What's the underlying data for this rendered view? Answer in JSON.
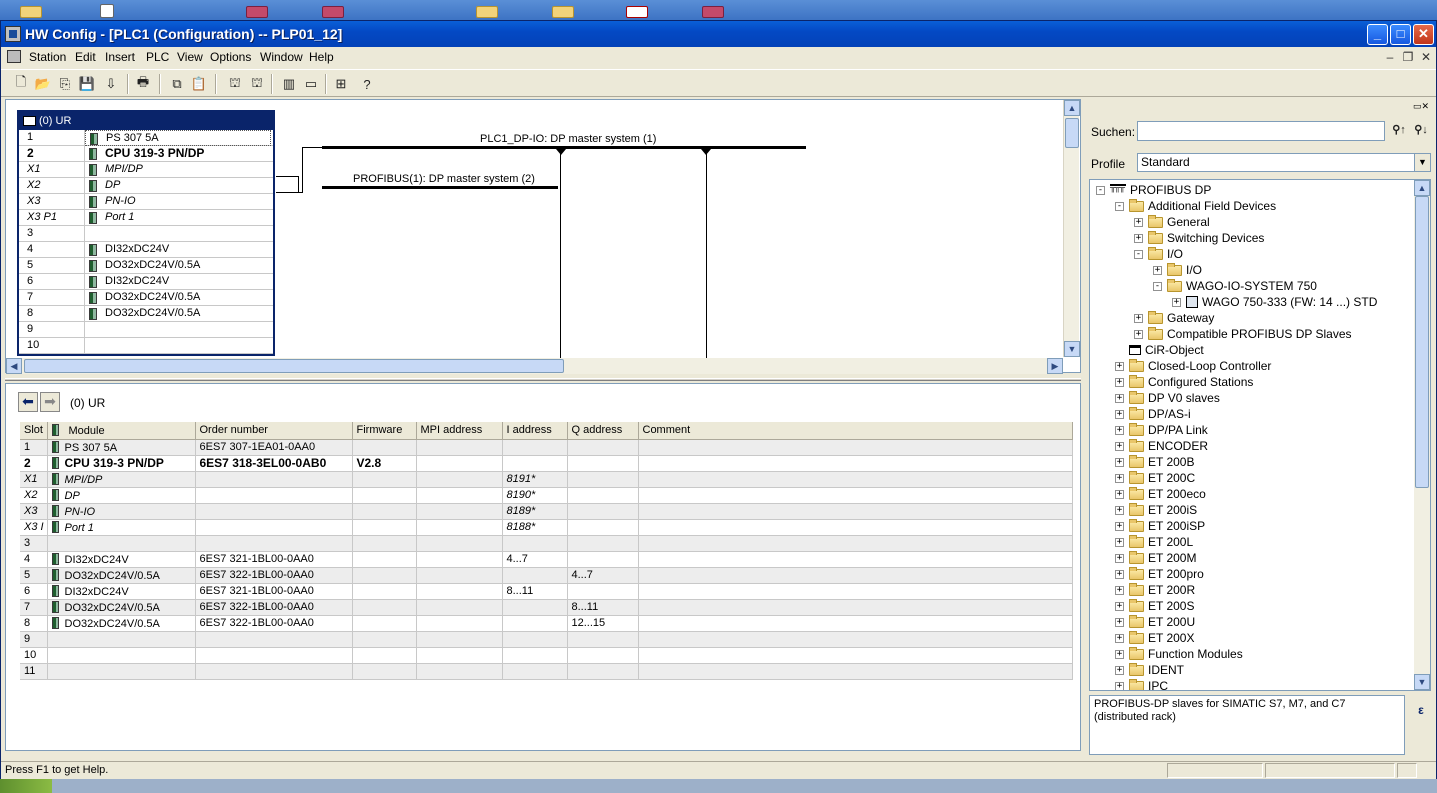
{
  "window": {
    "title": "HW Config - [PLC1 (Configuration) -- PLP01_12]"
  },
  "menu": [
    "Station",
    "Edit",
    "Insert",
    "PLC",
    "View",
    "Options",
    "Window",
    "Help"
  ],
  "toolbar": {
    "icons": [
      "new-icon",
      "open-icon",
      "save-compile-icon",
      "save-icon",
      "download-icon",
      "print-icon",
      "copy-icon",
      "paste-icon",
      "catalog-icon",
      "catalog2-icon",
      "module-info-icon",
      "monitor-icon",
      "network-icon",
      "help-icon"
    ]
  },
  "station": {
    "rack_title": "(0) UR",
    "rack_rows": [
      {
        "slot": "1",
        "module": "PS 307 5A"
      },
      {
        "slot": "2",
        "module": "CPU 319-3 PN/DP"
      },
      {
        "slot": "X1",
        "module": "MPI/DP"
      },
      {
        "slot": "X2",
        "module": "DP"
      },
      {
        "slot": "X3",
        "module": "PN-IO"
      },
      {
        "slot": "X3 P1",
        "module": "Port 1"
      },
      {
        "slot": "3",
        "module": ""
      },
      {
        "slot": "4",
        "module": "DI32xDC24V"
      },
      {
        "slot": "5",
        "module": "DO32xDC24V/0.5A"
      },
      {
        "slot": "6",
        "module": "DI32xDC24V"
      },
      {
        "slot": "7",
        "module": "DO32xDC24V/0.5A"
      },
      {
        "slot": "8",
        "module": "DO32xDC24V/0.5A"
      },
      {
        "slot": "9",
        "module": ""
      },
      {
        "slot": "10",
        "module": ""
      }
    ],
    "bus1_label": "PLC1_DP-IO: DP master system (1)",
    "bus2_label": "PROFIBUS(1): DP master system (2)"
  },
  "detail": {
    "title": "(0)  UR",
    "columns": [
      "Slot",
      "Module",
      "Order number",
      "Firmware",
      "MPI address",
      "I address",
      "Q address",
      "Comment"
    ],
    "rows": [
      {
        "slot": "1",
        "module": "PS 307 5A",
        "order": "6ES7 307-1EA01-0AA0",
        "fw": "",
        "mpi": "",
        "i": "",
        "q": "",
        "comment": ""
      },
      {
        "slot": "2",
        "module": "CPU 319-3 PN/DP",
        "order": "6ES7 318-3EL00-0AB0",
        "fw": "V2.8",
        "mpi": "",
        "i": "",
        "q": "",
        "comment": ""
      },
      {
        "slot": "X1",
        "module": "MPI/DP",
        "order": "",
        "fw": "",
        "mpi": "",
        "i": "8191*",
        "q": "",
        "comment": ""
      },
      {
        "slot": "X2",
        "module": "DP",
        "order": "",
        "fw": "",
        "mpi": "",
        "i": "8190*",
        "q": "",
        "comment": ""
      },
      {
        "slot": "X3",
        "module": "PN-IO",
        "order": "",
        "fw": "",
        "mpi": "",
        "i": "8189*",
        "q": "",
        "comment": ""
      },
      {
        "slot": "X3 I",
        "module": "Port 1",
        "order": "",
        "fw": "",
        "mpi": "",
        "i": "8188*",
        "q": "",
        "comment": ""
      },
      {
        "slot": "3",
        "module": "",
        "order": "",
        "fw": "",
        "mpi": "",
        "i": "",
        "q": "",
        "comment": ""
      },
      {
        "slot": "4",
        "module": "DI32xDC24V",
        "order": "6ES7 321-1BL00-0AA0",
        "fw": "",
        "mpi": "",
        "i": "4...7",
        "q": "",
        "comment": ""
      },
      {
        "slot": "5",
        "module": "DO32xDC24V/0.5A",
        "order": "6ES7 322-1BL00-0AA0",
        "fw": "",
        "mpi": "",
        "i": "",
        "q": "4...7",
        "comment": ""
      },
      {
        "slot": "6",
        "module": "DI32xDC24V",
        "order": "6ES7 321-1BL00-0AA0",
        "fw": "",
        "mpi": "",
        "i": "8...11",
        "q": "",
        "comment": ""
      },
      {
        "slot": "7",
        "module": "DO32xDC24V/0.5A",
        "order": "6ES7 322-1BL00-0AA0",
        "fw": "",
        "mpi": "",
        "i": "",
        "q": "8...11",
        "comment": ""
      },
      {
        "slot": "8",
        "module": "DO32xDC24V/0.5A",
        "order": "6ES7 322-1BL00-0AA0",
        "fw": "",
        "mpi": "",
        "i": "",
        "q": "12...15",
        "comment": ""
      },
      {
        "slot": "9",
        "module": "",
        "order": "",
        "fw": "",
        "mpi": "",
        "i": "",
        "q": "",
        "comment": ""
      },
      {
        "slot": "10",
        "module": "",
        "order": "",
        "fw": "",
        "mpi": "",
        "i": "",
        "q": "",
        "comment": ""
      },
      {
        "slot": "11",
        "module": "",
        "order": "",
        "fw": "",
        "mpi": "",
        "i": "",
        "q": "",
        "comment": ""
      }
    ]
  },
  "catalog": {
    "search_label": "Suchen:",
    "profile_label": "Profile",
    "profile_value": "Standard",
    "tree": [
      {
        "level": 0,
        "exp": "-",
        "icon": "dp",
        "label": "PROFIBUS DP"
      },
      {
        "level": 1,
        "exp": "-",
        "icon": "folder",
        "label": "Additional Field Devices"
      },
      {
        "level": 2,
        "exp": "+",
        "icon": "folder",
        "label": "General"
      },
      {
        "level": 2,
        "exp": "+",
        "icon": "folder",
        "label": "Switching Devices"
      },
      {
        "level": 2,
        "exp": "-",
        "icon": "folder",
        "label": "I/O"
      },
      {
        "level": 3,
        "exp": "+",
        "icon": "folder",
        "label": "I/O"
      },
      {
        "level": 3,
        "exp": "-",
        "icon": "folder",
        "label": "WAGO-IO-SYSTEM 750"
      },
      {
        "level": 4,
        "exp": "+",
        "icon": "device",
        "label": "WAGO 750-333 (FW: 14 ...) STD"
      },
      {
        "level": 2,
        "exp": "+",
        "icon": "folder",
        "label": "Gateway"
      },
      {
        "level": 2,
        "exp": "+",
        "icon": "folder",
        "label": "Compatible PROFIBUS DP Slaves"
      },
      {
        "level": 1,
        "exp": "",
        "icon": "cir",
        "label": "CiR-Object"
      },
      {
        "level": 1,
        "exp": "+",
        "icon": "folder",
        "label": "Closed-Loop Controller"
      },
      {
        "level": 1,
        "exp": "+",
        "icon": "folder",
        "label": "Configured Stations"
      },
      {
        "level": 1,
        "exp": "+",
        "icon": "folder",
        "label": "DP V0 slaves"
      },
      {
        "level": 1,
        "exp": "+",
        "icon": "folder",
        "label": "DP/AS-i"
      },
      {
        "level": 1,
        "exp": "+",
        "icon": "folder",
        "label": "DP/PA Link"
      },
      {
        "level": 1,
        "exp": "+",
        "icon": "folder",
        "label": "ENCODER"
      },
      {
        "level": 1,
        "exp": "+",
        "icon": "folder",
        "label": "ET 200B"
      },
      {
        "level": 1,
        "exp": "+",
        "icon": "folder",
        "label": "ET 200C"
      },
      {
        "level": 1,
        "exp": "+",
        "icon": "folder",
        "label": "ET 200eco"
      },
      {
        "level": 1,
        "exp": "+",
        "icon": "folder",
        "label": "ET 200iS"
      },
      {
        "level": 1,
        "exp": "+",
        "icon": "folder",
        "label": "ET 200iSP"
      },
      {
        "level": 1,
        "exp": "+",
        "icon": "folder",
        "label": "ET 200L"
      },
      {
        "level": 1,
        "exp": "+",
        "icon": "folder",
        "label": "ET 200M"
      },
      {
        "level": 1,
        "exp": "+",
        "icon": "folder",
        "label": "ET 200pro"
      },
      {
        "level": 1,
        "exp": "+",
        "icon": "folder",
        "label": "ET 200R"
      },
      {
        "level": 1,
        "exp": "+",
        "icon": "folder",
        "label": "ET 200S"
      },
      {
        "level": 1,
        "exp": "+",
        "icon": "folder",
        "label": "ET 200U"
      },
      {
        "level": 1,
        "exp": "+",
        "icon": "folder",
        "label": "ET 200X"
      },
      {
        "level": 1,
        "exp": "+",
        "icon": "folder",
        "label": "Function Modules"
      },
      {
        "level": 1,
        "exp": "+",
        "icon": "folder",
        "label": "IDENT"
      },
      {
        "level": 1,
        "exp": "+",
        "icon": "folder",
        "label": "IPC"
      }
    ],
    "description": "PROFIBUS-DP slaves for SIMATIC S7, M7, and C7 (distributed rack)"
  },
  "status": {
    "text": "Press F1 to get Help."
  }
}
